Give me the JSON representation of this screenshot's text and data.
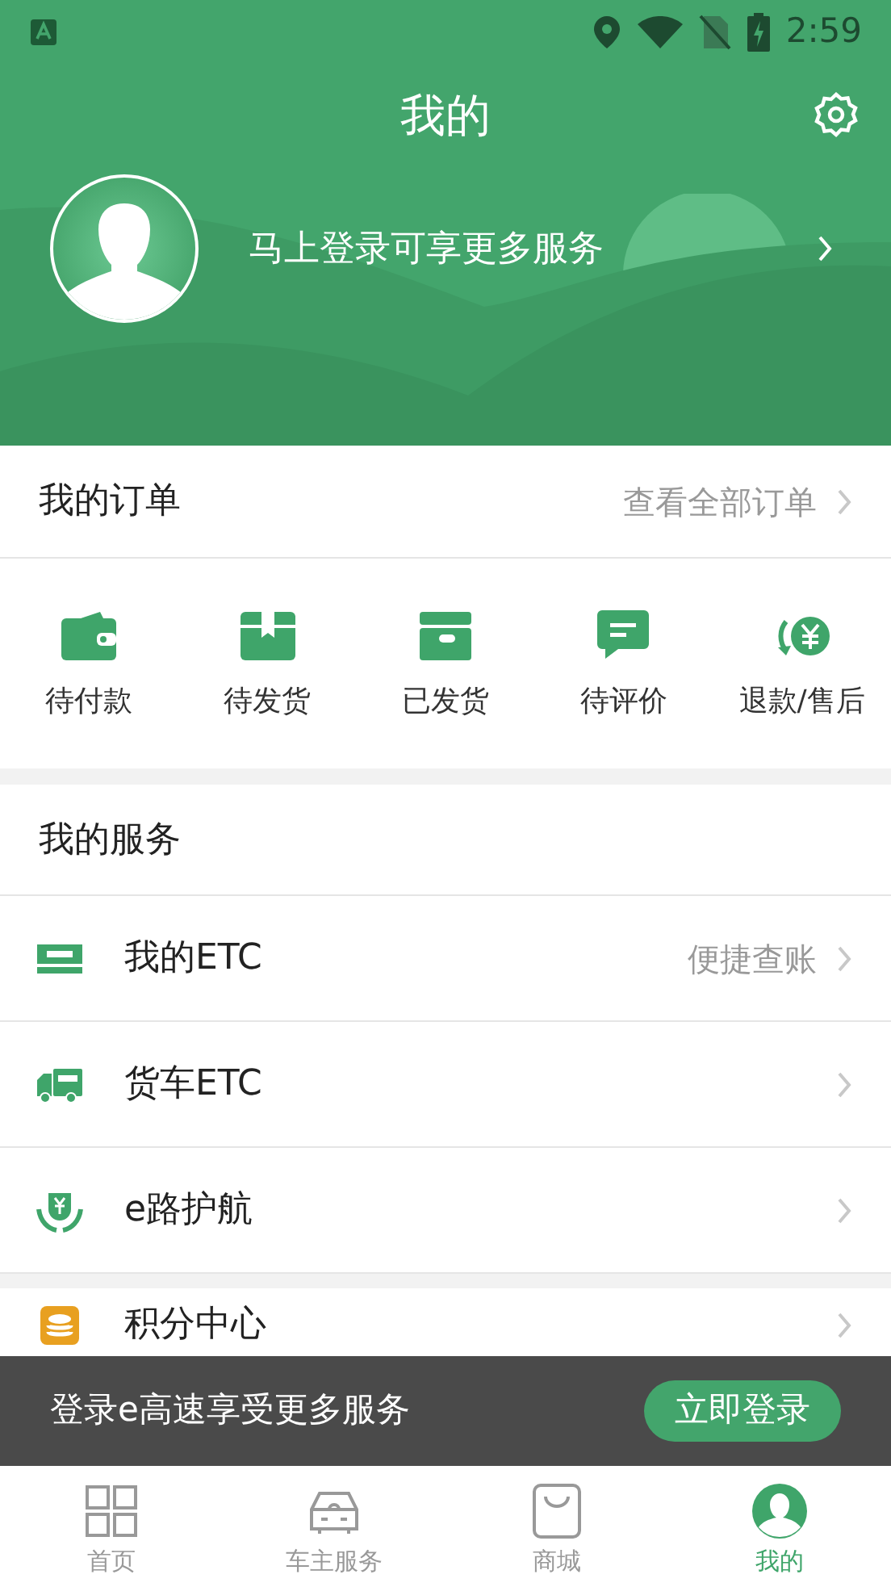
{
  "status_bar": {
    "time": "2:59"
  },
  "header": {
    "title": "我的",
    "login_prompt": "马上登录可享更多服务"
  },
  "orders": {
    "title": "我的订单",
    "link": "查看全部订单",
    "items": [
      {
        "kind": "wallet",
        "label": "待付款"
      },
      {
        "kind": "box",
        "label": "待发货"
      },
      {
        "kind": "shipped",
        "label": "已发货"
      },
      {
        "kind": "comment",
        "label": "待评价"
      },
      {
        "kind": "refund",
        "label": "退款/售后"
      }
    ]
  },
  "services": {
    "title": "我的服务",
    "items": [
      {
        "kind": "etc",
        "label": "我的ETC",
        "hint": "便捷查账"
      },
      {
        "kind": "truck",
        "label": "货车ETC"
      },
      {
        "kind": "shield",
        "label": "e路护航"
      }
    ]
  },
  "more_items": [
    {
      "kind": "coins",
      "label": "积分中心"
    }
  ],
  "toast": {
    "text": "登录e高速享受更多服务",
    "button": "立即登录"
  },
  "tab_bar": [
    {
      "kind": "home",
      "label": "首页",
      "selected": false
    },
    {
      "kind": "car",
      "label": "车主服务",
      "selected": false
    },
    {
      "kind": "shop",
      "label": "商城",
      "selected": false
    },
    {
      "kind": "me",
      "label": "我的",
      "selected": true
    }
  ]
}
